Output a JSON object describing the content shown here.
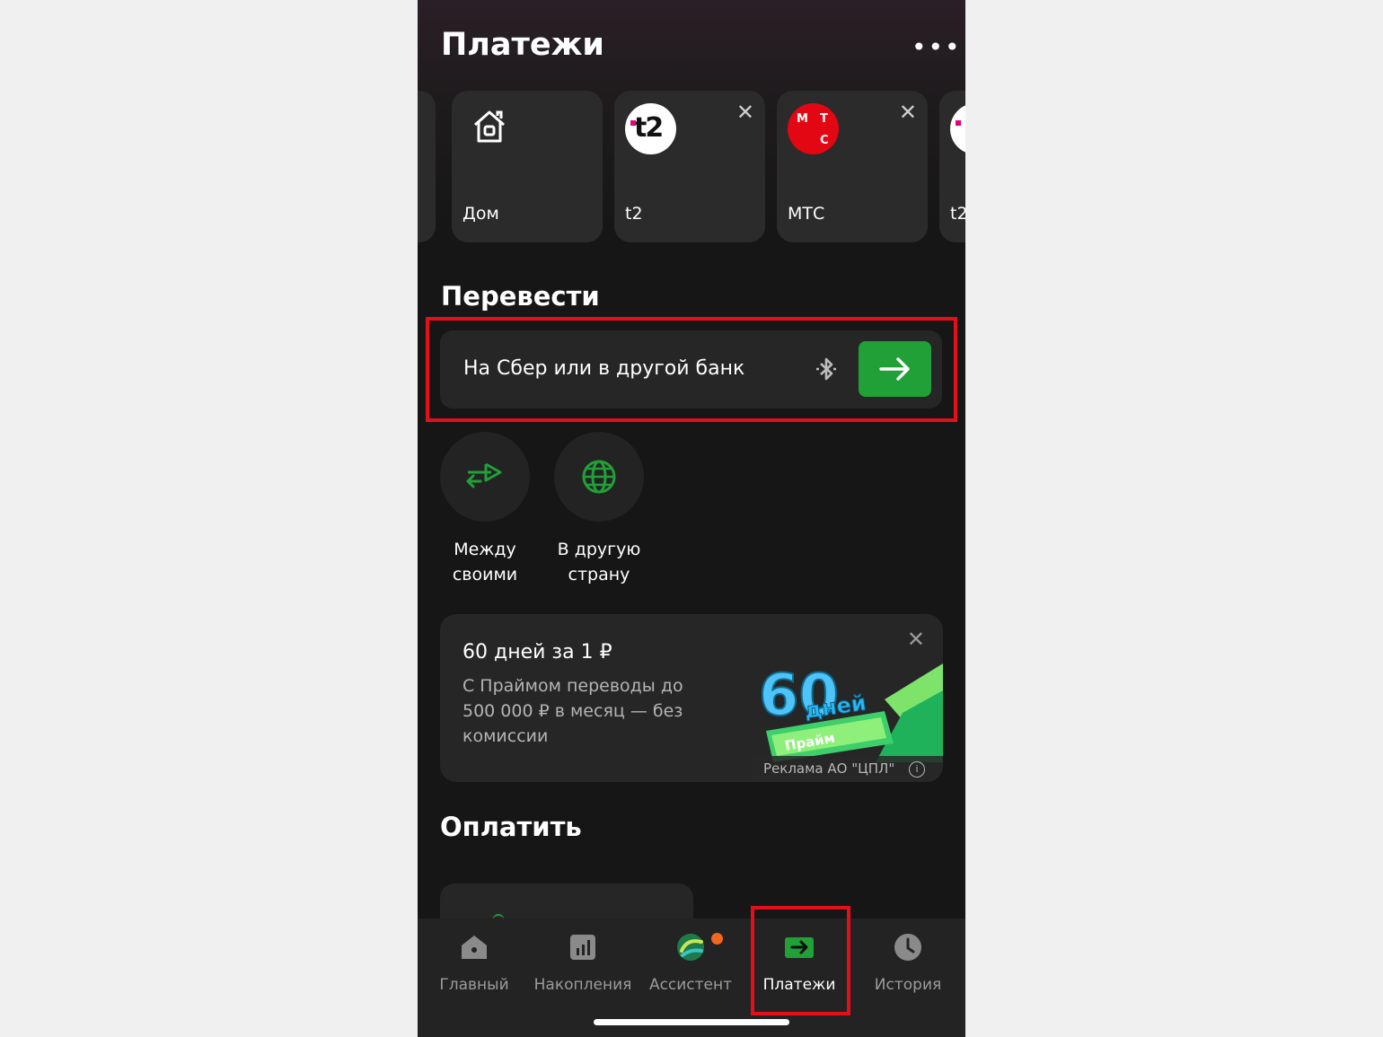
{
  "header": {
    "title": "Платежи",
    "more_icon": "more-horizontal-icon"
  },
  "quick_payments": [
    {
      "label": "Дом",
      "icon": "home-icon"
    },
    {
      "label": "t2",
      "logo_text": "t2",
      "removable": true
    },
    {
      "label": "МТС",
      "logo_letters": [
        "М",
        "Т",
        "С"
      ],
      "removable": true
    },
    {
      "label": "t2"
    }
  ],
  "transfer": {
    "title": "Перевести",
    "field_label": "На Сбер или в другой банк",
    "bluetooth_icon": "bluetooth-icon",
    "go_icon": "arrow-right-icon",
    "actions": [
      {
        "label_line1": "Между",
        "label_line2": "своими",
        "icon": "transfer-arrows-icon"
      },
      {
        "label_line1": "В другую",
        "label_line2": "страну",
        "icon": "globe-icon"
      }
    ]
  },
  "promo": {
    "heading": "60 дней за 1 ₽",
    "description": "С Праймом переводы до 500 000 ₽ в месяц — без комиссии",
    "image_number": "60",
    "image_days": "дней",
    "image_badge": "Прайм",
    "ad_label": "Реклама АО \"ЦПЛ\""
  },
  "pay": {
    "title": "Оплатить"
  },
  "tabbar": [
    {
      "label": "Главный",
      "icon": "home-icon",
      "active": false
    },
    {
      "label": "Накопления",
      "icon": "chart-icon",
      "active": false
    },
    {
      "label": "Ассистент",
      "icon": "assistant-icon",
      "active": false
    },
    {
      "label": "Платежи",
      "icon": "payments-icon",
      "active": true
    },
    {
      "label": "История",
      "icon": "clock-icon",
      "active": false
    }
  ],
  "colors": {
    "accent": "#21a038",
    "highlight": "#e3101c",
    "mts_red": "#e30613",
    "background": "#161616"
  }
}
